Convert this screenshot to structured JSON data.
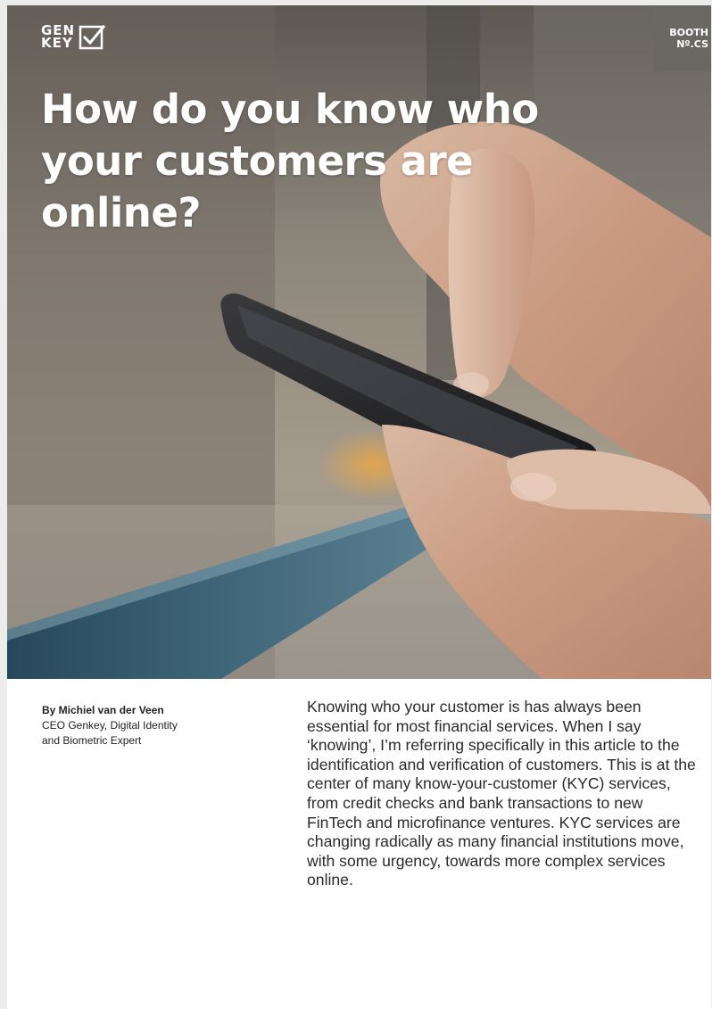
{
  "logo": {
    "line1": "GEN",
    "line2": "KEY",
    "check_icon": "checkbox-check-icon"
  },
  "booth": {
    "line1": "BOOTH",
    "line2": "Nº.CS"
  },
  "headline": "How do you know who your customers are online?",
  "hero_image": "hand-holding-smartphone-photo",
  "author": {
    "name": "By Michiel van der Veen",
    "role_line1": "CEO Genkey, Digital Identity",
    "role_line2": "and Biometric Expert"
  },
  "intro": "Knowing who your customer is has always been essential for most financial services. When I say ‘knowing’, I’m referring specifically in this article to the identification and verification of customers. This is at the center of many know-your-customer (KYC) services, from credit checks and bank transactions to new FinTech and microfinance ventures. KYC services are changing radically as many financial institutions move, with some urgency, towards more complex services online.",
  "colors": {
    "booth_bg": "#6b6864",
    "headline": "#ffffff",
    "body_text": "#2a2a2a"
  }
}
